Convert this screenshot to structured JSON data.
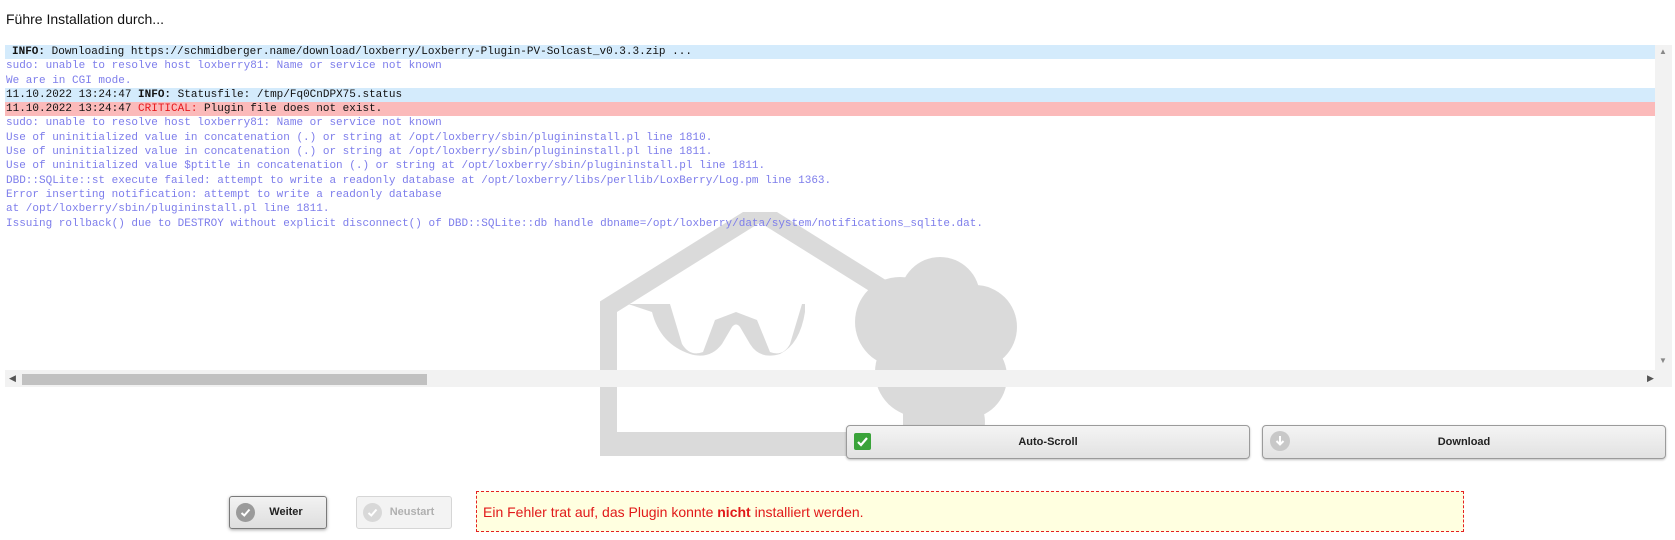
{
  "page": {
    "heading": "Führe Installation durch..."
  },
  "log": {
    "lines": [
      {
        "type": "info",
        "prefix": "",
        "level": "INFO:",
        "text": " Downloading https://schmidberger.name/download/loxberry/Loxberry-Plugin-PV-Solcast_v0.3.3.zip ..."
      },
      {
        "type": "plain",
        "text": "sudo: unable to resolve host loxberry81: Name or service not known"
      },
      {
        "type": "plain",
        "text": "We are in CGI mode."
      },
      {
        "type": "info",
        "prefix": "11.10.2022 13:24:47 ",
        "level": "INFO:",
        "text": " Statusfile: /tmp/Fq0CnDPX75.status"
      },
      {
        "type": "critical",
        "prefix": "11.10.2022 13:24:47 ",
        "level": "CRITICAL:",
        "text": " Plugin file does not exist."
      },
      {
        "type": "plain",
        "text": "sudo: unable to resolve host loxberry81: Name or service not known"
      },
      {
        "type": "plain",
        "text": "Use of uninitialized value in concatenation (.) or string at /opt/loxberry/sbin/plugininstall.pl line 1810."
      },
      {
        "type": "plain",
        "text": "Use of uninitialized value in concatenation (.) or string at /opt/loxberry/sbin/plugininstall.pl line 1811."
      },
      {
        "type": "plain",
        "text": "Use of uninitialized value $ptitle in concatenation (.) or string at /opt/loxberry/sbin/plugininstall.pl line 1811."
      },
      {
        "type": "plain",
        "text": "DBD::SQLite::st execute failed: attempt to write a readonly database at /opt/loxberry/libs/perllib/LoxBerry/Log.pm line 1363."
      },
      {
        "type": "plain",
        "text": "Error inserting notification: attempt to write a readonly database"
      },
      {
        "type": "plain",
        "text": "at /opt/loxberry/sbin/plugininstall.pl line 1811."
      },
      {
        "type": "plain",
        "text": "Issuing rollback() due to DESTROY without explicit disconnect() of DBD::SQLite::db handle dbname=/opt/loxberry/data/system/notifications_sqlite.dat."
      }
    ]
  },
  "buttons": {
    "autoscroll": "Auto-Scroll",
    "download": "Download",
    "weiter": "Weiter",
    "neustart": "Neustart"
  },
  "error": {
    "before": "Ein Fehler trat auf, das Plugin konnte ",
    "emphasis": "nicht",
    "after": " installiert werden."
  },
  "colors": {
    "info_bg": "#d4ebfc",
    "critical_bg": "#fbbaba",
    "log_text": "#7d7deb",
    "autoscroll_check": "#3aa33a",
    "error_text": "#e11919",
    "error_bg": "#ffffe0"
  }
}
